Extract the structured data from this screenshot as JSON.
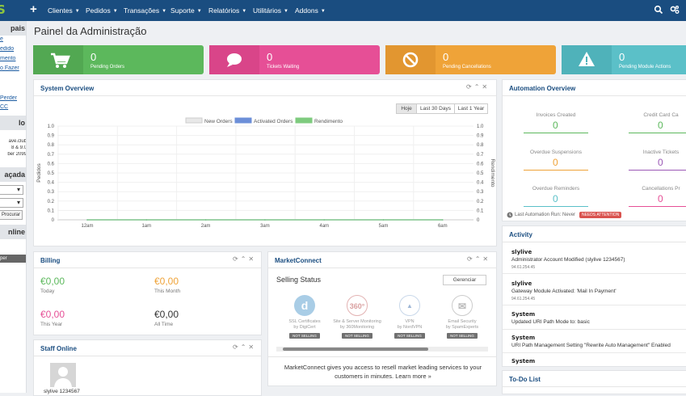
{
  "colors": {
    "topbar": "#1a4d80",
    "green": "#5cb85c",
    "pink": "#e64f96",
    "orange": "#efa338",
    "teal": "#5bc0c8",
    "title_blue": "#1a4d80",
    "needs_attention": "#d9534f"
  },
  "logo": {
    "text": "S"
  },
  "topnav": {
    "add_icon": "plus-icon",
    "items": [
      "Clientes",
      "Pedidos",
      "Transações",
      "Suporte",
      "Relatórios",
      "Utilitários",
      "Addons"
    ],
    "search_icon": "search-icon",
    "settings_icon": "gears-icon"
  },
  "sidebar": {
    "head1": "pais",
    "links": [
      "e",
      "edido",
      "mento",
      "o Fazer"
    ],
    "links2": [
      "Perder",
      "CC"
    ],
    "head2": "lo",
    "info": [
      "ave.club",
      "8 & 9.0",
      "ber 2099"
    ],
    "head3": "açada",
    "search_btn": "Procurar",
    "head4": "nline",
    "user_tag": "per"
  },
  "page_title": "Painel da Administração",
  "stats": [
    {
      "value": "0",
      "label": "Pending Orders",
      "icon": "cart-icon"
    },
    {
      "value": "0",
      "label": "Tickets Waiting",
      "icon": "comment-icon"
    },
    {
      "value": "0",
      "label": "Pending Cancellations",
      "icon": "ban-icon"
    },
    {
      "value": "0",
      "label": "Pending Module Actions",
      "icon": "warning-icon"
    }
  ],
  "system_overview": {
    "title": "System Overview",
    "range_buttons": [
      "Hoje",
      "Last 30 Days",
      "Last 1 Year"
    ],
    "active_range": "Hoje"
  },
  "chart_data": {
    "type": "line",
    "legend": [
      "New Orders",
      "Activated Orders",
      "Rendimento"
    ],
    "legend_colors": [
      "#e8e8e8",
      "#6c8fd8",
      "#7ecb7e"
    ],
    "x": [
      "12am",
      "1am",
      "2am",
      "3am",
      "4am",
      "5am",
      "6am"
    ],
    "y_ticks": [
      "1.0",
      "0.9",
      "0.8",
      "0.7",
      "0.6",
      "0.5",
      "0.4",
      "0.3",
      "0.2",
      "0.1",
      "0"
    ],
    "ylabel_left": "Pedidos",
    "ylabel_right": "Rendimento",
    "ylim": [
      0,
      1
    ],
    "series": [
      {
        "name": "New Orders",
        "values": [
          0,
          0,
          0,
          0,
          0,
          0,
          0
        ]
      },
      {
        "name": "Activated Orders",
        "values": [
          0,
          0,
          0,
          0,
          0,
          0,
          0
        ]
      },
      {
        "name": "Rendimento",
        "values": [
          0,
          0,
          0,
          0,
          0,
          0,
          0
        ]
      }
    ],
    "legend_position": "top"
  },
  "automation": {
    "title": "Automation Overview",
    "items": [
      {
        "label": "Invoices Created",
        "value": "0",
        "color": "#5cb85c"
      },
      {
        "label": "Credit Card Ca",
        "value": "0",
        "color": "#5cb85c"
      },
      {
        "label": "Overdue Suspensions",
        "value": "0",
        "color": "#efa338"
      },
      {
        "label": "Inactive Tickets",
        "value": "0",
        "color": "#9b59b6"
      },
      {
        "label": "Overdue Reminders",
        "value": "0",
        "color": "#5bc0c8"
      },
      {
        "label": "Cancellations Pr",
        "value": "0",
        "color": "#e64f96"
      }
    ],
    "last_run_label": "Last Automation Run:",
    "last_run_value": "Never",
    "needs_attention": "NEEDS ATTENTION"
  },
  "activity": {
    "title": "Activity",
    "entries": [
      {
        "who": "slylive",
        "text": "Administrator Account Modified (slylive 1234567)",
        "ip": "94.61.254.45"
      },
      {
        "who": "slylive",
        "text": "Gateway Module Activated: 'Mail In Payment'",
        "ip": "94.61.254.45"
      },
      {
        "who": "System",
        "text": "Updated URI Path Mode to: basic",
        "ip": ""
      },
      {
        "who": "System",
        "text": "URI Path Management Setting \"Rewrite Auto Management\" Enabled",
        "ip": ""
      },
      {
        "who": "System",
        "text": "",
        "ip": ""
      }
    ]
  },
  "todo": {
    "title": "To-Do List"
  },
  "billing": {
    "title": "Billing",
    "cells": [
      {
        "value": "€0,00",
        "label": "Today",
        "color": "#5cb85c"
      },
      {
        "value": "€0,00",
        "label": "This Month",
        "color": "#efa338"
      },
      {
        "value": "€0,00",
        "label": "This Year",
        "color": "#e64f96"
      },
      {
        "value": "€0,00",
        "label": "All Time",
        "color": "#333333"
      }
    ]
  },
  "staff": {
    "title": "Staff Online",
    "user": "slylive 1234567"
  },
  "marketconnect": {
    "title": "MarketConnect",
    "selling_status": "Selling Status",
    "manage_btn": "Gerenciar",
    "services": [
      {
        "name": "SSL Certificates",
        "by": "by DigiCert",
        "status": "NOT SELLING",
        "icon": "digicert-icon"
      },
      {
        "name": "Site & Server Monitoring",
        "by": "by 360Monitoring",
        "status": "NOT SELLING",
        "icon": "monitoring-360-icon"
      },
      {
        "name": "VPN",
        "by": "by NordVPN",
        "status": "NOT SELLING",
        "icon": "nordvpn-icon"
      },
      {
        "name": "Email Security",
        "by": "by SpamExperts",
        "status": "NOT SELLING",
        "icon": "email-security-icon"
      }
    ],
    "blurb1": "MarketConnect gives you access to resell market leading services to your",
    "blurb2": "customers in minutes. Learn more »"
  }
}
